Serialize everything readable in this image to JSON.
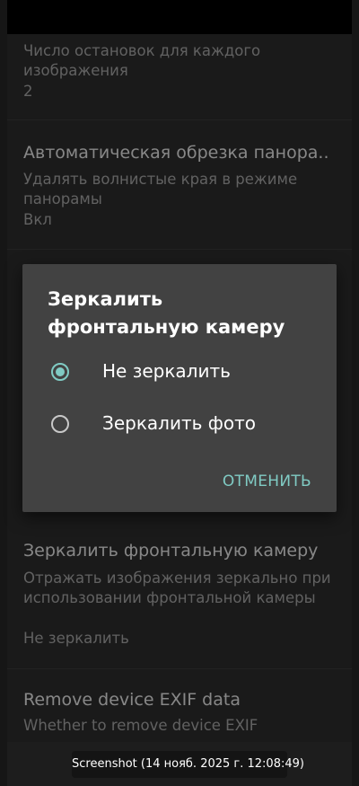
{
  "settings": {
    "items": [
      {
        "title": "",
        "summary": "Число остановок для каждого изображения",
        "value": "2"
      },
      {
        "title": "Автоматическая обрезка панора..",
        "summary": "Удалять волнистые края в режиме панорамы",
        "value": "Вкл"
      },
      {
        "title": "Зеркалить фронтальную камеру",
        "summary": "Отражать изображения зеркально при использовании фронтальной камеры",
        "value": "Не зеркалить"
      },
      {
        "title": "Remove device EXIF data",
        "summary": "Whether to remove device EXIF",
        "value": ""
      }
    ]
  },
  "dialog": {
    "title": "Зеркалить фронтальную камеру",
    "options": [
      {
        "label": "Не зеркалить",
        "selected": true
      },
      {
        "label": "Зеркалить фото",
        "selected": false
      }
    ],
    "cancel_label": "ОТМЕНИТЬ",
    "accent_color": "#80cbc4"
  },
  "toast": {
    "text": "Screenshot (14 нояб. 2025 г. 12:08:49)"
  }
}
